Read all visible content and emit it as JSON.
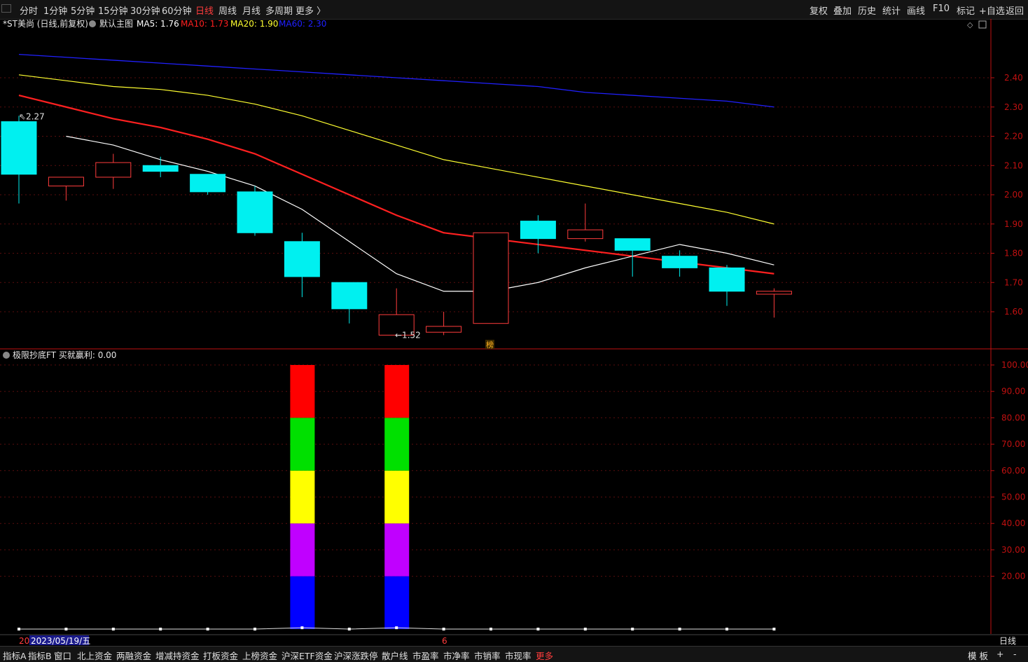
{
  "toolbar": {
    "periods": [
      "分时",
      "1分钟",
      "5分钟",
      "15分钟",
      "30分钟",
      "60分钟",
      "日线",
      "周线",
      "月线",
      "多周期",
      "更多 〉"
    ],
    "active_period": "日线",
    "right_items": [
      "复权",
      "叠加",
      "历史",
      "统计",
      "画线",
      "F10",
      "标记",
      "+自选",
      "返回"
    ]
  },
  "main_panel": {
    "stock_label": "*ST美尚 (日线,前复权)",
    "chart_label": "默认主图",
    "ma_labels": [
      {
        "text": "MA5: 1.76",
        "color": "#ffffff"
      },
      {
        "text": "MA10: 1.73",
        "color": "#ff2020"
      },
      {
        "text": "MA20: 1.90",
        "color": "#ffff30"
      },
      {
        "text": "MA60: 2.30",
        "color": "#2020ff"
      }
    ],
    "high_marker": "2.27",
    "low_marker": "←1.52",
    "rank_marker": "榜"
  },
  "indicator_panel": {
    "label": "极限抄底FT  买就赢利: 0.00"
  },
  "date_bar": {
    "left_fragment": "20",
    "date": "2023/05/19/五",
    "mid_fragment": "6",
    "right_label": "日线"
  },
  "bottom_tabs": [
    "指标A",
    "指标B",
    "窗口",
    "北上资金",
    "两融资金",
    "增减持资金",
    "打板资金",
    "上榜资金",
    "沪深ETF资金",
    "沪深涨跌停",
    "散户线",
    "市盈率",
    "市净率",
    "市销率",
    "市现率",
    "更多"
  ],
  "bottom_active": "更多",
  "bottom_right": [
    "模 板",
    "+",
    "-"
  ],
  "colors": {
    "up": "#ff3c3c",
    "down": "#00f0f0",
    "ma5": "#ffffff",
    "ma10": "#ff2020",
    "ma20": "#ffff30",
    "ma60": "#2020ff",
    "axis": "#c01010"
  },
  "chart_data": [
    {
      "type": "candlestick",
      "title": "*ST美尚 (日线,前复权)",
      "yticks": [
        2.4,
        2.3,
        2.2,
        2.1,
        2.0,
        1.9,
        1.8,
        1.7,
        1.6
      ],
      "ylim": [
        1.48,
        2.55
      ],
      "candles": [
        {
          "o": 2.25,
          "h": 2.27,
          "l": 1.97,
          "c": 2.07
        },
        {
          "o": 2.03,
          "h": 2.05,
          "l": 1.98,
          "c": 2.06
        },
        {
          "o": 2.06,
          "h": 2.14,
          "l": 2.02,
          "c": 2.11
        },
        {
          "o": 2.1,
          "h": 2.13,
          "l": 2.06,
          "c": 2.08
        },
        {
          "o": 2.07,
          "h": 2.07,
          "l": 2.0,
          "c": 2.01
        },
        {
          "o": 2.01,
          "h": 2.03,
          "l": 1.86,
          "c": 1.87
        },
        {
          "o": 1.84,
          "h": 1.87,
          "l": 1.65,
          "c": 1.72
        },
        {
          "o": 1.7,
          "h": 1.7,
          "l": 1.56,
          "c": 1.61
        },
        {
          "o": 1.52,
          "h": 1.68,
          "l": 1.52,
          "c": 1.59
        },
        {
          "o": 1.53,
          "h": 1.6,
          "l": 1.52,
          "c": 1.55
        },
        {
          "o": 1.56,
          "h": 1.87,
          "l": 1.56,
          "c": 1.87
        },
        {
          "o": 1.91,
          "h": 1.93,
          "l": 1.8,
          "c": 1.85
        },
        {
          "o": 1.85,
          "h": 1.97,
          "l": 1.84,
          "c": 1.88
        },
        {
          "o": 1.85,
          "h": 1.85,
          "l": 1.72,
          "c": 1.81
        },
        {
          "o": 1.79,
          "h": 1.81,
          "l": 1.72,
          "c": 1.75
        },
        {
          "o": 1.75,
          "h": 1.76,
          "l": 1.62,
          "c": 1.67
        },
        {
          "o": 1.66,
          "h": 1.68,
          "l": 1.58,
          "c": 1.67
        }
      ],
      "ma5": [
        null,
        2.2,
        2.17,
        2.12,
        2.08,
        2.03,
        1.95,
        1.84,
        1.73,
        1.67,
        1.67,
        1.7,
        1.75,
        1.79,
        1.83,
        1.8,
        1.76
      ],
      "ma10": [
        2.34,
        2.3,
        2.26,
        2.23,
        2.19,
        2.14,
        2.07,
        2.0,
        1.93,
        1.87,
        1.85,
        1.83,
        1.81,
        1.79,
        1.77,
        1.75,
        1.73
      ],
      "ma20": [
        2.41,
        2.39,
        2.37,
        2.36,
        2.34,
        2.31,
        2.27,
        2.22,
        2.17,
        2.12,
        2.09,
        2.06,
        2.03,
        2.0,
        1.97,
        1.94,
        1.9
      ],
      "ma60": [
        2.48,
        2.47,
        2.46,
        2.45,
        2.44,
        2.43,
        2.42,
        2.41,
        2.4,
        2.39,
        2.38,
        2.37,
        2.35,
        2.34,
        2.33,
        2.32,
        2.3
      ]
    },
    {
      "type": "bar",
      "title": "极限抄底FT",
      "yticks": [
        100,
        90,
        80,
        70,
        60,
        50,
        40,
        30,
        20
      ],
      "ylim": [
        0,
        104
      ],
      "bars": [
        {
          "index": 6,
          "segments": [
            {
              "from": 0,
              "to": 20,
              "color": "#0000ff"
            },
            {
              "from": 20,
              "to": 40,
              "color": "#c000ff"
            },
            {
              "from": 40,
              "to": 60,
              "color": "#ffff00"
            },
            {
              "from": 60,
              "to": 80,
              "color": "#00e000"
            },
            {
              "from": 80,
              "to": 100,
              "color": "#ff0000"
            }
          ]
        },
        {
          "index": 8,
          "segments": [
            {
              "from": 0,
              "to": 20,
              "color": "#0000ff"
            },
            {
              "from": 20,
              "to": 40,
              "color": "#c000ff"
            },
            {
              "from": 40,
              "to": 60,
              "color": "#ffff00"
            },
            {
              "from": 60,
              "to": 80,
              "color": "#00e000"
            },
            {
              "from": 80,
              "to": 100,
              "color": "#ff0000"
            }
          ]
        }
      ],
      "line": [
        0,
        0,
        0,
        0,
        0,
        0,
        0.5,
        0,
        0.5,
        0,
        0,
        0,
        0,
        0,
        0,
        0,
        0
      ]
    }
  ]
}
